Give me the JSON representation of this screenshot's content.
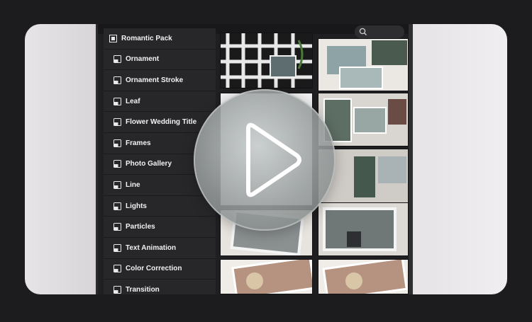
{
  "sidebar": {
    "pack_title": "Romantic Pack",
    "items": [
      {
        "label": "Ornament",
        "icon": "ae-file-icon"
      },
      {
        "label": "Ornament Stroke",
        "icon": "ae-file-icon"
      },
      {
        "label": "Leaf",
        "icon": "ae-file-icon"
      },
      {
        "label": "Flower Wedding Title",
        "icon": "ae-file-icon"
      },
      {
        "label": "Frames",
        "icon": "ae-file-icon"
      },
      {
        "label": "Photo Gallery",
        "icon": "ae-file-icon"
      },
      {
        "label": "Line",
        "icon": "ae-file-icon"
      },
      {
        "label": "Lights",
        "icon": "ae-file-icon"
      },
      {
        "label": "Particles",
        "icon": "ae-file-icon"
      },
      {
        "label": "Text Animation",
        "icon": "ae-file-icon"
      },
      {
        "label": "Color Correction",
        "icon": "document-icon"
      },
      {
        "label": "Transition",
        "icon": "ae-file-icon"
      }
    ]
  },
  "search": {
    "icon": "search-icon"
  },
  "player": {
    "icon": "play-icon"
  },
  "colors": {
    "page_bg": "#1c1c1e",
    "panel_bg": "#1f1f21",
    "item_bg": "#27272a",
    "text": "#f2f2f2"
  }
}
